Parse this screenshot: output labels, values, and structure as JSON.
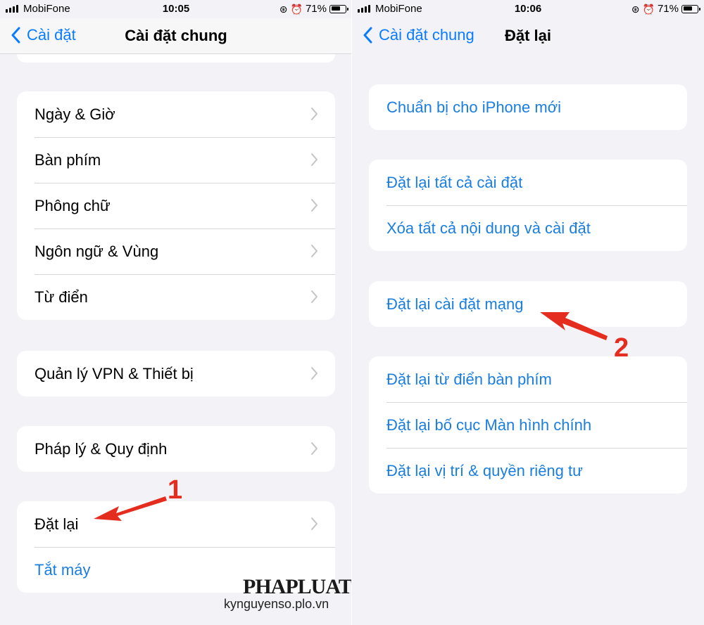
{
  "left": {
    "status": {
      "carrier": "MobiFone",
      "time": "10:05",
      "battery": "71%",
      "battery_level": 0.71
    },
    "nav": {
      "back_label": "Cài đặt",
      "title": "Cài đặt chung"
    },
    "groups": [
      [
        "Ngày & Giờ",
        "Bàn phím",
        "Phông chữ",
        "Ngôn ngữ & Vùng",
        "Từ điển"
      ],
      [
        "Quản lý VPN & Thiết bị"
      ],
      [
        "Pháp lý & Quy định"
      ]
    ],
    "reset_group": {
      "reset_label": "Đặt lại",
      "shutdown_label": "Tắt máy"
    },
    "annotation": "1"
  },
  "right": {
    "status": {
      "carrier": "MobiFone",
      "time": "10:06",
      "battery": "71%",
      "battery_level": 0.71
    },
    "nav": {
      "back_label": "Cài đặt chung",
      "title": "Đặt lại"
    },
    "groups": [
      [
        "Chuẩn bị cho iPhone mới"
      ],
      [
        "Đặt lại tất cả cài đặt",
        "Xóa tất cả nội dung và cài đặt"
      ],
      [
        "Đặt lại cài đặt mạng"
      ],
      [
        "Đặt lại từ điển bàn phím",
        "Đặt lại bố cục Màn hình chính",
        "Đặt lại vị trí & quyền riêng tư"
      ]
    ],
    "annotation": "2"
  },
  "colors": {
    "accent": "#0a7cff",
    "action_text": "#1a7ee0",
    "annotation": "#e52d1f",
    "background": "#f2f2f7"
  },
  "watermark": {
    "logo": "PHAPLUAT",
    "url": "kynguyenso.plo.vn"
  },
  "icons": {
    "back": "chevron-left-icon",
    "disclosure": "chevron-right-icon",
    "alarm": "alarm-icon",
    "lock_rotation": "orientation-lock-icon"
  }
}
